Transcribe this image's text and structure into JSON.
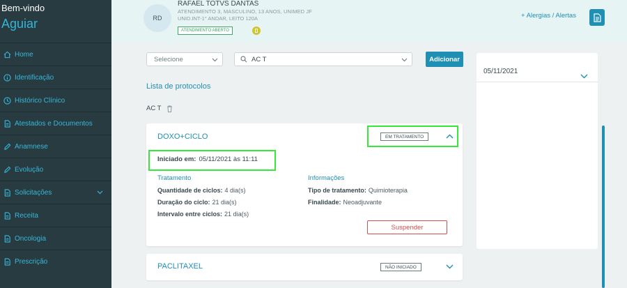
{
  "sidebar": {
    "welcome": "Bem-vindo",
    "user": "Aguiar",
    "items": [
      {
        "label": "Home",
        "icon": "home-icon"
      },
      {
        "label": "Identificação",
        "icon": "info-icon"
      },
      {
        "label": "Histórico Clínico",
        "icon": "history-icon"
      },
      {
        "label": "Atestados e Documentos",
        "icon": "document-icon"
      },
      {
        "label": "Anamnese",
        "icon": "pencil-icon"
      },
      {
        "label": "Evolução",
        "icon": "pencil-icon"
      },
      {
        "label": "Solicitações",
        "icon": "document-icon"
      },
      {
        "label": "Receita",
        "icon": "document-icon"
      },
      {
        "label": "Oncologia",
        "icon": "document-icon"
      },
      {
        "label": "Prescrição",
        "icon": "document-icon"
      }
    ]
  },
  "header": {
    "avatar_initials": "RD",
    "patient_name": "RAFAEL TOTVS DANTAS",
    "patient_info_1": "ATENDIMENTO 3, MASCULINO, 13 ANOS, UNIMED JF",
    "patient_info_2": "UNID.INT-1° ANDAR, LEITO 120A",
    "status_badge": "ATENDIMENTO ABERTO",
    "alerts_link": "+ Alergias / Alertas"
  },
  "filters": {
    "select_value": "Selecione",
    "search_value": "AC T",
    "add_button": "Adicionar"
  },
  "protocols": {
    "list_title": "Lista de protocolos",
    "selected": "AC T"
  },
  "cards": [
    {
      "title": "DOXO+CICLO",
      "status": "EM TRATAMENTO",
      "started_label": "Iniciado em:",
      "started_value": "05/11/2021 às 11:11",
      "treatment_title": "Tratamento",
      "cycles_label": "Quantidade de ciclos:",
      "cycles_value": "4 dia(s)",
      "duration_label": "Duração do ciclo:",
      "duration_value": "21 dia(s)",
      "interval_label": "Intervalo entre ciclos:",
      "interval_value": "21 dia(s)",
      "info_title": "Informações",
      "type_label": "Tipo de tratamento:",
      "type_value": "Quimioterapia",
      "purpose_label": "Finalidade:",
      "purpose_value": "Neoadjuvante",
      "suspend_button": "Suspender"
    },
    {
      "title": "PACLITAXEL",
      "status": "NÃO INICIADO"
    }
  ],
  "right_panel": {
    "date": "05/11/2021"
  },
  "colors": {
    "sidebar_bg": "#273b40",
    "accent": "#1f8fb4",
    "highlight": "#36e83a",
    "danger": "#d05050",
    "success": "#3aa864"
  }
}
